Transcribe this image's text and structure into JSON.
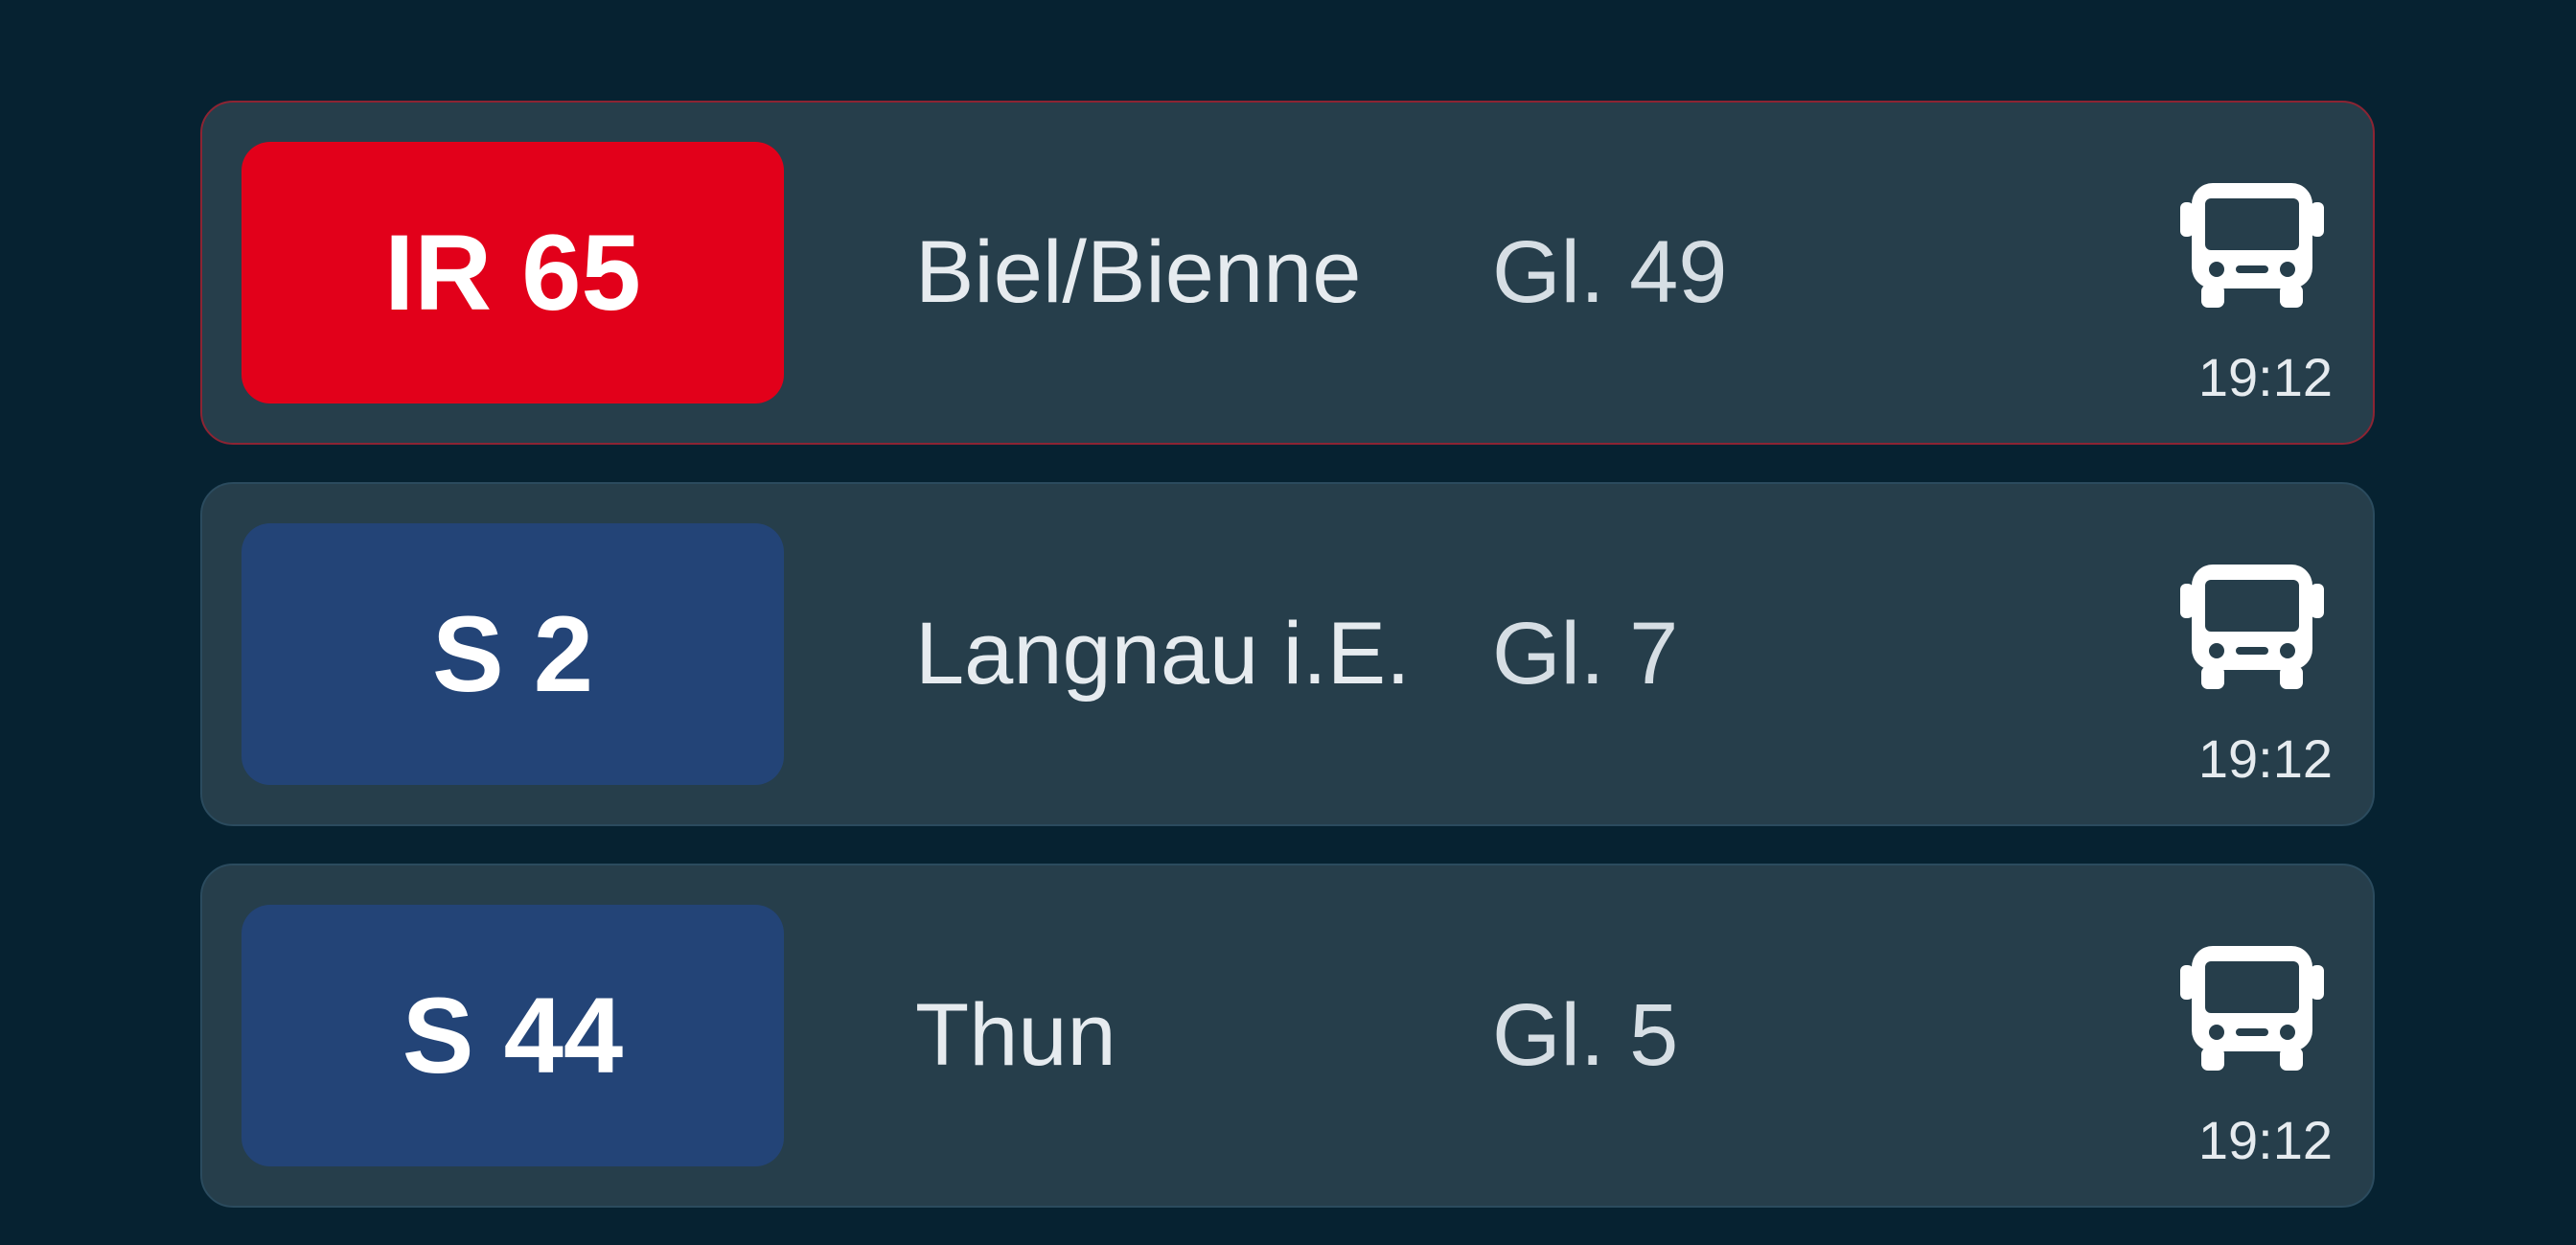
{
  "departures": [
    {
      "line": "IR 65",
      "line_color": "#e2001a",
      "destination": "Biel/Bienne",
      "platform": "Gl. 49",
      "icon": "bus-icon",
      "time": "19:12",
      "highlight": true
    },
    {
      "line": "S 2",
      "line_color": "#234477",
      "destination": "Langnau i.E.",
      "platform": "Gl. 7",
      "icon": "bus-icon",
      "time": "19:12",
      "highlight": false
    },
    {
      "line": "S 44",
      "line_color": "#234477",
      "destination": "Thun",
      "platform": "Gl. 5",
      "icon": "bus-icon",
      "time": "19:12",
      "highlight": false
    }
  ],
  "colors": {
    "background": "#062231",
    "card": "#263e4b",
    "text": "#e6ebef"
  }
}
